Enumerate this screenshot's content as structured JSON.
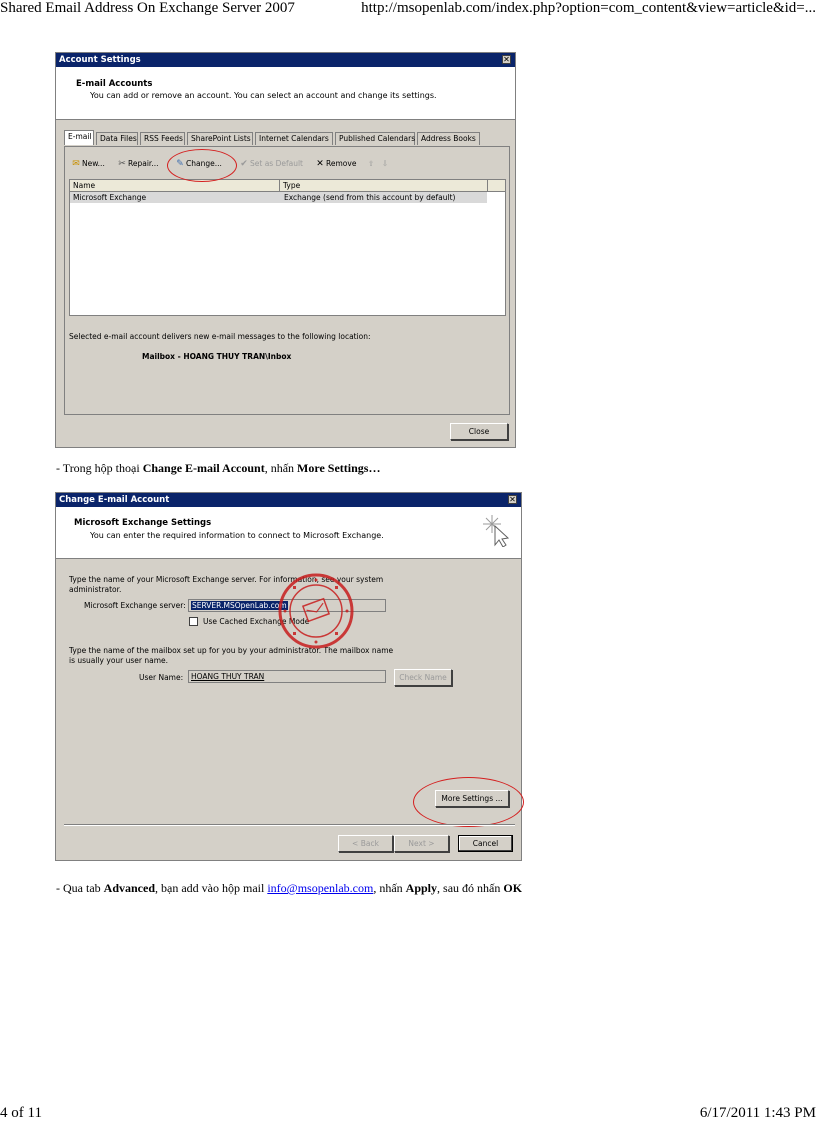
{
  "page": {
    "header_title": "Shared Email Address On Exchange Server 2007",
    "header_url": "http://msopenlab.com/index.php?option=com_content&view=article&id=...",
    "footer_page": "4 of 11",
    "footer_datetime": "6/17/2011 1:43 PM"
  },
  "account_settings": {
    "title": "Account Settings",
    "header_title": "E-mail Accounts",
    "header_desc": "You can add or remove an account. You can select an account and change its settings.",
    "tabs": [
      {
        "label": "E-mail"
      },
      {
        "label": "Data Files"
      },
      {
        "label": "RSS Feeds"
      },
      {
        "label": "SharePoint Lists"
      },
      {
        "label": "Internet Calendars"
      },
      {
        "label": "Published Calendars"
      },
      {
        "label": "Address Books"
      }
    ],
    "toolbar": {
      "new": "New...",
      "repair": "Repair...",
      "change": "Change...",
      "set_default": "Set as Default",
      "remove": "Remove"
    },
    "columns": {
      "name": "Name",
      "type": "Type"
    },
    "rows": [
      {
        "name": "Microsoft Exchange",
        "type": "Exchange (send from this account by default)"
      }
    ],
    "delivery_text": "Selected e-mail account delivers new e-mail messages to the following location:",
    "mailbox": "Mailbox - HOANG THUY TRAN\\Inbox",
    "close_label": "Close"
  },
  "caption1": {
    "prefix": "- Trong hộp thoại ",
    "bold1": "Change E-mail Account",
    "middle": ", nhấn ",
    "bold2": "More Settings…"
  },
  "change_email": {
    "title": "Change E-mail Account",
    "header_title": "Microsoft Exchange Settings",
    "header_desc": "You can enter the required information to connect to Microsoft Exchange.",
    "server_text_1": "Type the name of your Microsoft Exchange server. For information, see your system",
    "server_text_2": "administrator.",
    "server_label": "Microsoft Exchange server:",
    "server_value": "SERVER.MSOpenLab.com",
    "cached_mode_label": "Use Cached Exchange Mode",
    "mailbox_text_1": "Type the name of the mailbox set up for you by your administrator. The mailbox name",
    "mailbox_text_2": "is usually your user name.",
    "user_label": "User Name:",
    "user_value": "HOANG THUY TRAN",
    "check_name_label": "Check Name",
    "more_settings_label": "More Settings ...",
    "back_label": "< Back",
    "next_label": "Next >",
    "cancel_label": "Cancel"
  },
  "caption2": {
    "prefix": "- Qua tab ",
    "bold1": "Advanced",
    "middle1": ", bạn add vào hộp mail ",
    "link": "info@msopenlab.com",
    "middle2": ", nhấn ",
    "bold2": "Apply",
    "middle3": ", sau đó nhấn ",
    "bold3": "OK"
  },
  "colors": {
    "titlebar": "#0a246a",
    "dialog_bg": "#d4d0c8",
    "highlight_circle": "#d42020",
    "stamp": "#c81e1e",
    "link": "#0000ee"
  }
}
